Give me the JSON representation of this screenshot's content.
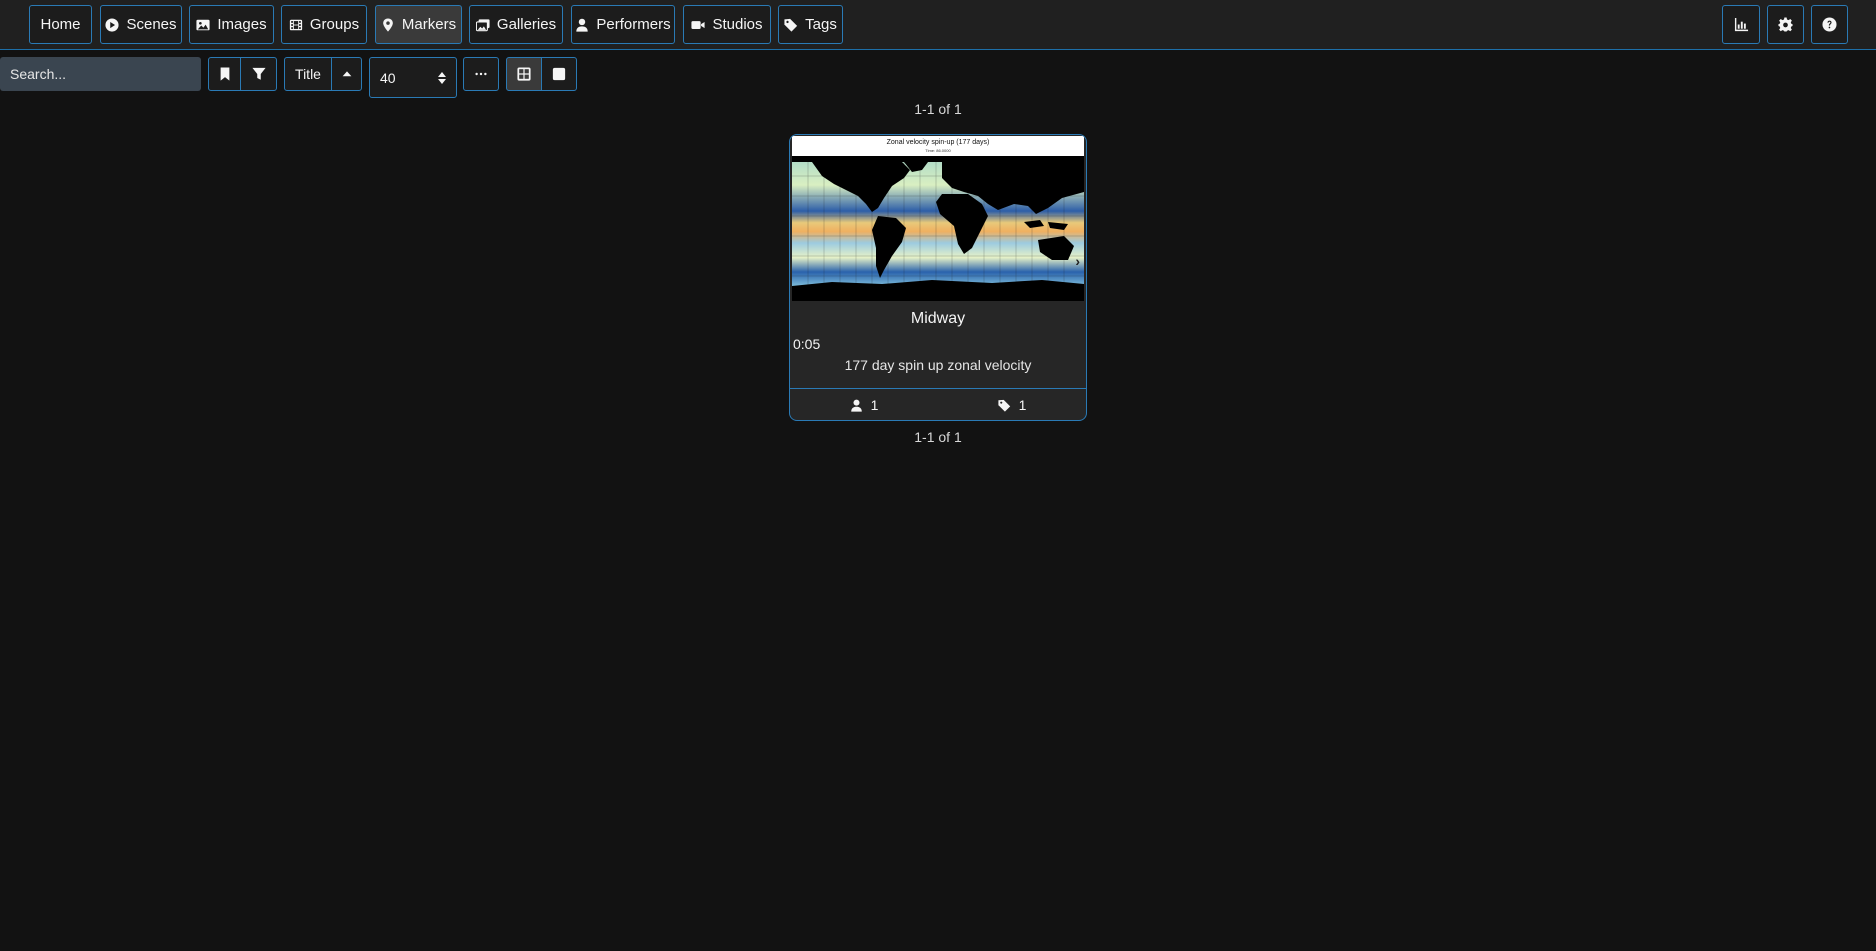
{
  "nav": {
    "items": [
      {
        "label": "Home",
        "icon": "none"
      },
      {
        "label": "Scenes",
        "icon": "play-circle-icon"
      },
      {
        "label": "Images",
        "icon": "image-icon"
      },
      {
        "label": "Groups",
        "icon": "film-icon"
      },
      {
        "label": "Markers",
        "icon": "map-marker-icon",
        "active": true
      },
      {
        "label": "Galleries",
        "icon": "images-icon"
      },
      {
        "label": "Performers",
        "icon": "user-icon"
      },
      {
        "label": "Studios",
        "icon": "video-icon"
      },
      {
        "label": "Tags",
        "icon": "tag-icon"
      }
    ],
    "right_icons": [
      "chart-icon",
      "gear-icon",
      "help-icon"
    ]
  },
  "toolbar": {
    "search_placeholder": "Search...",
    "sort_label": "Title",
    "per_page": "40",
    "more_icon": "ellipsis-icon",
    "view_modes": [
      "grid-icon",
      "wall-icon"
    ]
  },
  "pagination": {
    "top": "1-1 of 1",
    "bottom": "1-1 of 1"
  },
  "markers": [
    {
      "preview_title": "Zonal velocity spin-up (177 days)",
      "preview_subtitle": "Time: 86.0000",
      "title": "Midway",
      "time": "0:05",
      "description": "177 day spin up zonal velocity",
      "performer_count": "1",
      "tag_count": "1"
    }
  ],
  "colors": {
    "accent": "#2a7ab5",
    "background": "#121212",
    "navbar": "#202020",
    "card": "#262626"
  }
}
